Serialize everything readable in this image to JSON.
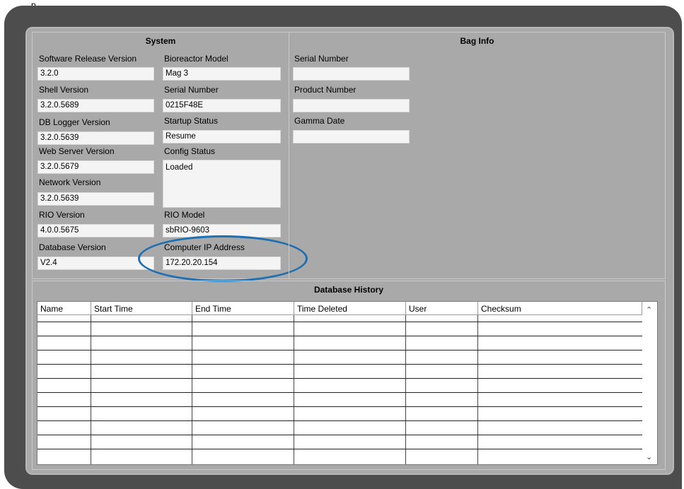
{
  "top_text": "p",
  "system": {
    "title": "System",
    "left_fields": [
      {
        "label": "Software Release Version",
        "value": "3.2.0"
      },
      {
        "label": "Shell Version",
        "value": "3.2.0.5689"
      },
      {
        "label": "DB Logger Version",
        "value": "3.2.0.5639"
      },
      {
        "label": "Web Server Version",
        "value": "3.2.0.5679"
      },
      {
        "label": "Network Version",
        "value": "3.2.0.5639"
      },
      {
        "label": "RIO Version",
        "value": "4.0.0.5675"
      },
      {
        "label": "Database Version",
        "value": "V2.4"
      }
    ],
    "right_fields": [
      {
        "label": "Bioreactor Model",
        "value": "Mag 3"
      },
      {
        "label": "Serial Number",
        "value": "0215F48E"
      },
      {
        "label": "Startup Status",
        "value": "Resume"
      },
      {
        "label": "Config Status",
        "value": "Loaded"
      },
      {
        "label": "RIO Model",
        "value": "sbRIO-9603"
      },
      {
        "label": "Computer IP Address",
        "value": "172.20.20.154"
      }
    ]
  },
  "bag_info": {
    "title": "Bag Info",
    "fields": [
      {
        "label": "Serial Number",
        "value": ""
      },
      {
        "label": "Product Number",
        "value": ""
      },
      {
        "label": "Gamma Date",
        "value": ""
      }
    ]
  },
  "database_history": {
    "title": "Database History",
    "columns": [
      "Name",
      "Start Time",
      "End Time",
      "Time Deleted",
      "User",
      "Checksum"
    ],
    "rows": []
  },
  "colors": {
    "frame": "#4d4d4d",
    "panel": "#a9a9a9",
    "highlight": "#1f6fb3"
  }
}
